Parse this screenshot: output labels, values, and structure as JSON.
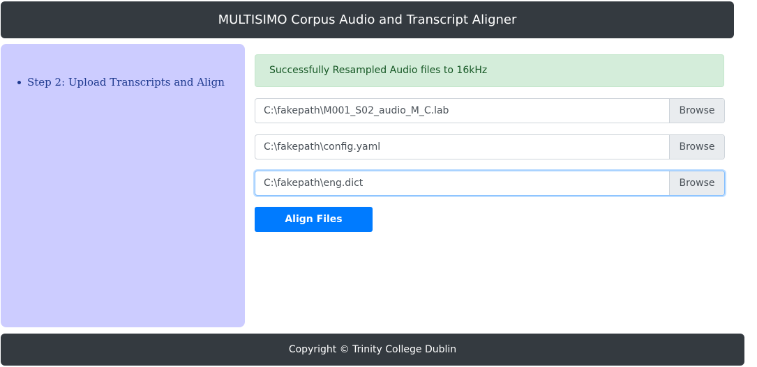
{
  "header": {
    "title": "MULTISIMO Corpus Audio and Transcript Aligner"
  },
  "sidebar": {
    "items": [
      {
        "label": "Step 2: Upload Transcripts and Align"
      }
    ]
  },
  "main": {
    "alert": "Successfully Resampled Audio files to 16kHz",
    "files": [
      {
        "value": "C:\\fakepath\\M001_S02_audio_M_C.lab",
        "browse_label": "Browse"
      },
      {
        "value": "C:\\fakepath\\config.yaml",
        "browse_label": "Browse"
      },
      {
        "value": "C:\\fakepath\\eng.dict",
        "browse_label": "Browse"
      }
    ],
    "align_button": "Align Files"
  },
  "footer": {
    "text": "Copyright © Trinity College Dublin"
  }
}
